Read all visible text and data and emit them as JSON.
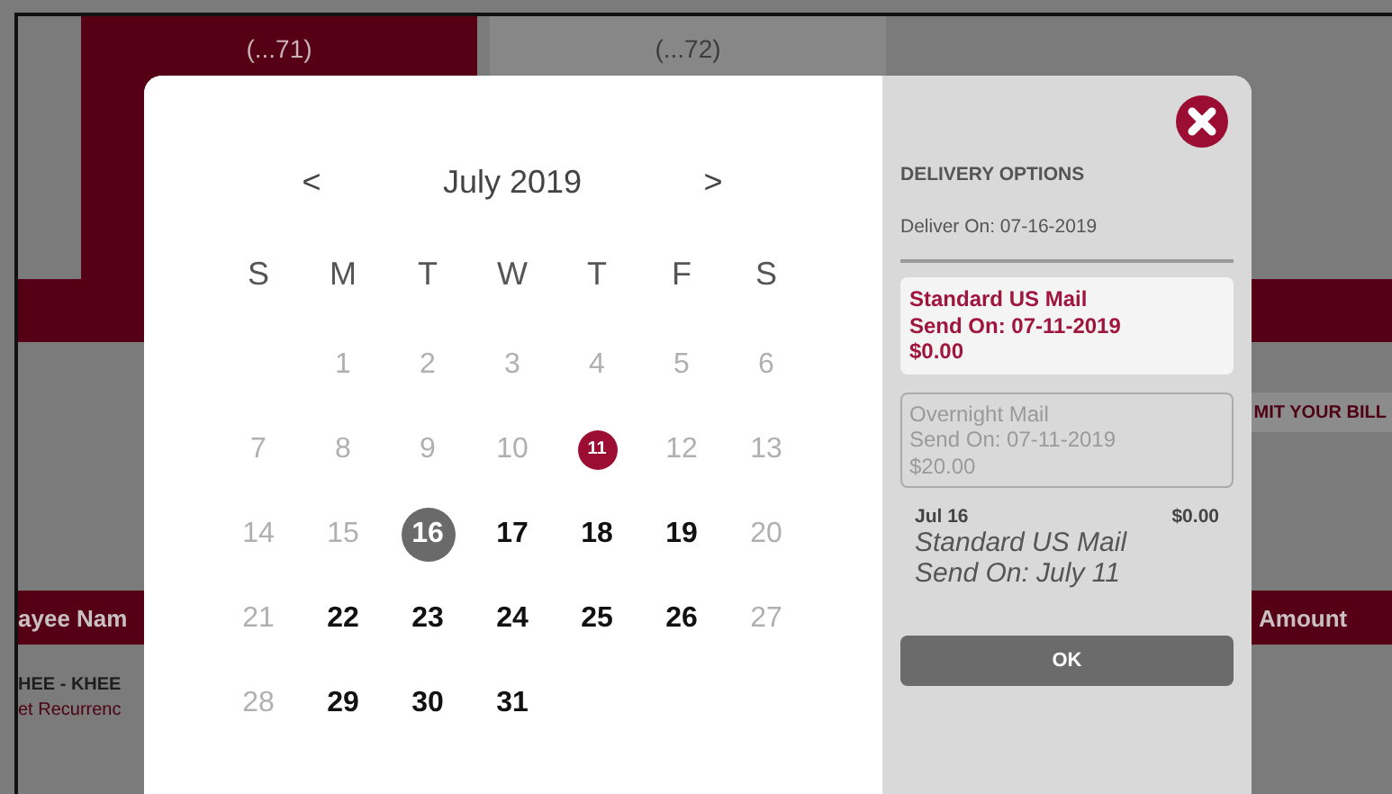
{
  "background": {
    "accounts": [
      {
        "number": "(...71)",
        "selected": true
      },
      {
        "number": "(...72)",
        "selected": false
      }
    ],
    "submit_button": "MIT YOUR BILL",
    "table": {
      "columns": [
        "ayee Nam",
        "Amount"
      ],
      "rows": [
        {
          "payee": "HEE - KHEE",
          "note": "et Recurrenc"
        }
      ]
    }
  },
  "calendar": {
    "prev": "<",
    "month": "July 2019",
    "next": ">",
    "weekdays": [
      "S",
      "M",
      "T",
      "W",
      "T",
      "F",
      "S"
    ],
    "weeks": [
      [
        {
          "label": "1",
          "disabled": true,
          "selected": false,
          "send_date": false
        },
        {
          "label": "2",
          "disabled": true,
          "selected": false,
          "send_date": false
        },
        {
          "label": "3",
          "disabled": true,
          "selected": false,
          "send_date": false
        },
        {
          "label": "4",
          "disabled": true,
          "selected": false,
          "send_date": false
        },
        {
          "label": "5",
          "disabled": true,
          "selected": false,
          "send_date": false
        },
        {
          "label": "6",
          "disabled": true,
          "selected": false,
          "send_date": false
        }
      ],
      [
        {
          "label": "7",
          "disabled": true,
          "selected": false,
          "send_date": false
        },
        {
          "label": "8",
          "disabled": true,
          "selected": false,
          "send_date": false
        },
        {
          "label": "9",
          "disabled": true,
          "selected": false,
          "send_date": false
        },
        {
          "label": "10",
          "disabled": true,
          "selected": false,
          "send_date": false
        },
        {
          "label": "11",
          "disabled": false,
          "selected": false,
          "send_date": true
        },
        {
          "label": "12",
          "disabled": true,
          "selected": false,
          "send_date": false
        },
        {
          "label": "13",
          "disabled": true,
          "selected": false,
          "send_date": false
        }
      ],
      [
        {
          "label": "14",
          "disabled": true,
          "selected": false,
          "send_date": false
        },
        {
          "label": "15",
          "disabled": true,
          "selected": false,
          "send_date": false
        },
        {
          "label": "16",
          "disabled": false,
          "selected": true,
          "send_date": false
        },
        {
          "label": "17",
          "disabled": false,
          "selected": false,
          "send_date": false
        },
        {
          "label": "18",
          "disabled": false,
          "selected": false,
          "send_date": false
        },
        {
          "label": "19",
          "disabled": false,
          "selected": false,
          "send_date": false
        },
        {
          "label": "20",
          "disabled": true,
          "selected": false,
          "send_date": false
        }
      ],
      [
        {
          "label": "21",
          "disabled": true,
          "selected": false,
          "send_date": false
        },
        {
          "label": "22",
          "disabled": false,
          "selected": false,
          "send_date": false
        },
        {
          "label": "23",
          "disabled": false,
          "selected": false,
          "send_date": false
        },
        {
          "label": "24",
          "disabled": false,
          "selected": false,
          "send_date": false
        },
        {
          "label": "25",
          "disabled": false,
          "selected": false,
          "send_date": false
        },
        {
          "label": "26",
          "disabled": false,
          "selected": false,
          "send_date": false
        },
        {
          "label": "27",
          "disabled": true,
          "selected": false,
          "send_date": false
        }
      ],
      [
        {
          "label": "28",
          "disabled": true,
          "selected": false,
          "send_date": false
        },
        {
          "label": "29",
          "disabled": false,
          "selected": false,
          "send_date": false
        },
        {
          "label": "30",
          "disabled": false,
          "selected": false,
          "send_date": false
        },
        {
          "label": "31",
          "disabled": false,
          "selected": false,
          "send_date": false
        }
      ]
    ]
  },
  "delivery": {
    "title": "DELIVERY OPTIONS",
    "deliver_on": "Deliver On: 07-16-2019",
    "options": [
      {
        "method": "Standard US Mail",
        "send_on": "Send On: 07-11-2019",
        "price": "$0.00",
        "selected": true
      },
      {
        "method": "Overnight Mail",
        "send_on": "Send On: 07-11-2019",
        "price": "$20.00",
        "selected": false
      }
    ],
    "summary": {
      "date": "Jul 16",
      "amount": "$0.00",
      "method": "Standard US Mail",
      "send_on": "Send On: July 11"
    },
    "ok_button": "OK"
  }
}
